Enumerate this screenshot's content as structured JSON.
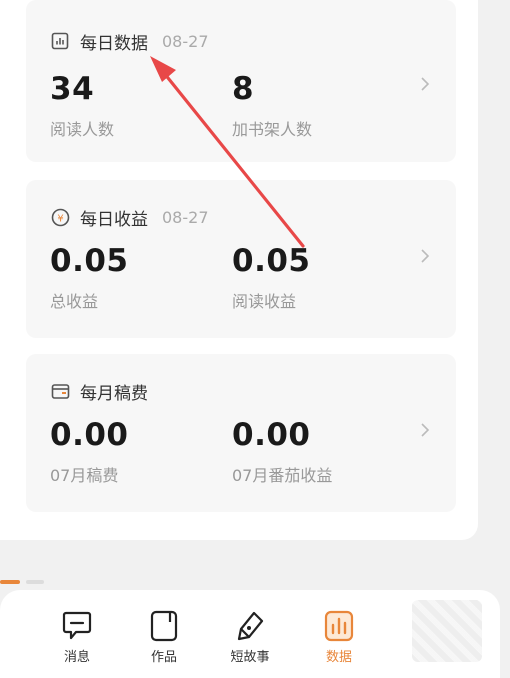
{
  "cards": [
    {
      "title": "每日数据",
      "date": "08-27",
      "icon": "bar-chart-icon",
      "metrics": [
        {
          "value": "34",
          "label": "阅读人数"
        },
        {
          "value": "8",
          "label": "加书架人数"
        }
      ]
    },
    {
      "title": "每日收益",
      "date": "08-27",
      "icon": "yen-coin-icon",
      "metrics": [
        {
          "value": "0.05",
          "label": "总收益"
        },
        {
          "value": "0.05",
          "label": "阅读收益"
        }
      ]
    },
    {
      "title": "每月稿费",
      "date": "",
      "icon": "wallet-icon",
      "metrics": [
        {
          "value": "0.00",
          "label": "07月稿费"
        },
        {
          "value": "0.00",
          "label": "07月番茄收益"
        }
      ]
    }
  ],
  "tabbar": {
    "items": [
      {
        "label": "消息",
        "icon": "message-icon"
      },
      {
        "label": "作品",
        "icon": "works-icon"
      },
      {
        "label": "短故事",
        "icon": "pen-icon"
      },
      {
        "label": "数据",
        "icon": "data-icon",
        "active": true
      }
    ]
  },
  "colors": {
    "accent": "#e8863a",
    "annotation_arrow": "#e84848",
    "card_bg": "#f7f7f7"
  }
}
